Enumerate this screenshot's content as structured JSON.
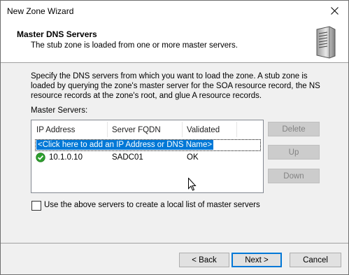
{
  "window": {
    "title": "New Zone Wizard"
  },
  "header": {
    "title": "Master DNS Servers",
    "subtitle": "The stub zone is loaded from one or more master servers."
  },
  "description": "Specify the DNS servers from which you want to load the zone. A stub zone is loaded by querying the zone's master server for the SOA resource record, the NS resource records at the zone's root, and glue A resource records.",
  "master_servers": {
    "label": "Master Servers:",
    "columns": [
      "IP Address",
      "Server FQDN",
      "Validated"
    ],
    "add_placeholder": "<Click here to add an IP Address or DNS Name>",
    "rows": [
      {
        "ip": "10.1.0.10",
        "fqdn": "SADC01",
        "validated": "OK",
        "status_icon": "check-circle-icon"
      }
    ]
  },
  "side_buttons": {
    "delete": "Delete",
    "up": "Up",
    "down": "Down"
  },
  "checkbox": {
    "label": "Use the above servers to create a local list of master servers",
    "checked": false
  },
  "footer": {
    "back": "< Back",
    "next": "Next >",
    "cancel": "Cancel"
  },
  "colors": {
    "selection": "#0078d7",
    "ok_green": "#2ea02e"
  }
}
